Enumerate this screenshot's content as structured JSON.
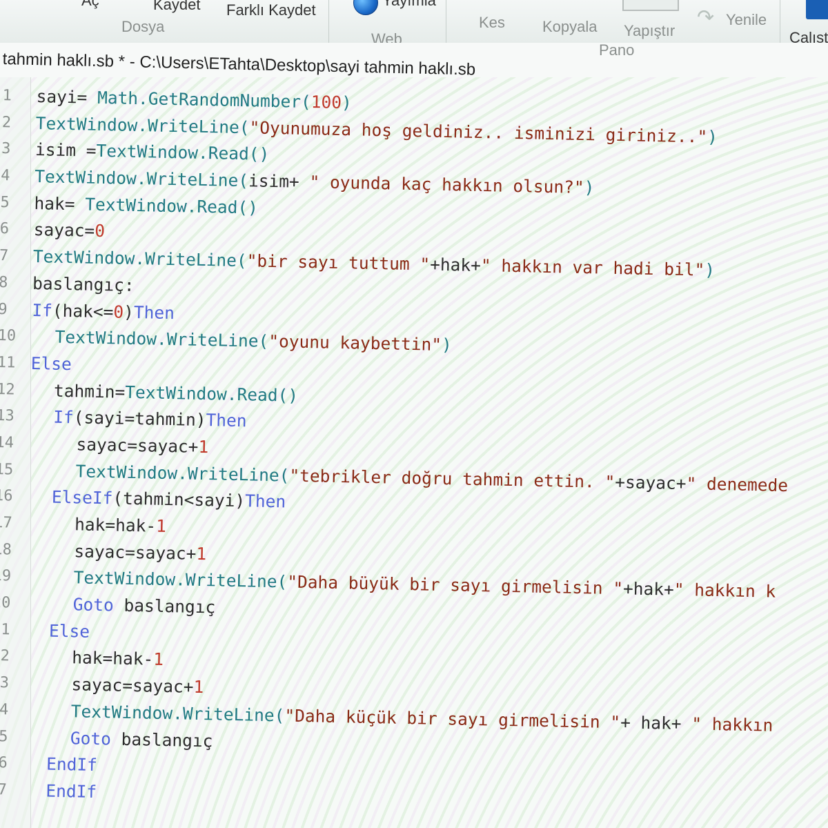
{
  "ribbon": {
    "items": {
      "open": "Aç",
      "save": "Kaydet",
      "save_as": "Farklı Kaydet",
      "publish": "Yayımla",
      "cut": "Kes",
      "copy": "Kopyala",
      "paste": "Yapıştır",
      "redo": "Yenile",
      "run": "Çalıştı"
    },
    "groups": {
      "file": "Dosya",
      "web": "Web",
      "clipboard": "Pano"
    }
  },
  "document": {
    "title": "tahmin haklı.sb * - C:\\Users\\ETahta\\Desktop\\sayi tahmin haklı.sb"
  },
  "editor": {
    "lines": [
      {
        "n": "1",
        "indent": 0,
        "tokens": [
          [
            "plain",
            "sayi= "
          ],
          [
            "obj",
            "Math.GetRandomNumber("
          ],
          [
            "num",
            "100"
          ],
          [
            "obj",
            ")"
          ]
        ]
      },
      {
        "n": "2",
        "indent": 0,
        "tokens": [
          [
            "obj",
            "TextWindow.WriteLine("
          ],
          [
            "str",
            "\"Oyunumuza hoş geldiniz.. isminizi giriniz..\""
          ],
          [
            "obj",
            ")"
          ]
        ]
      },
      {
        "n": "3",
        "indent": 0,
        "tokens": [
          [
            "plain",
            "isim ="
          ],
          [
            "obj",
            "TextWindow.Read()"
          ]
        ]
      },
      {
        "n": "4",
        "indent": 0,
        "tokens": [
          [
            "obj",
            "TextWindow.WriteLine("
          ],
          [
            "plain",
            "isim+ "
          ],
          [
            "str",
            "\" oyunda kaç hakkın olsun?\""
          ],
          [
            "obj",
            ")"
          ]
        ]
      },
      {
        "n": "5",
        "indent": 0,
        "tokens": [
          [
            "plain",
            "hak= "
          ],
          [
            "obj",
            "TextWindow.Read()"
          ]
        ]
      },
      {
        "n": "6",
        "indent": 0,
        "tokens": [
          [
            "plain",
            "sayac="
          ],
          [
            "num",
            "0"
          ]
        ]
      },
      {
        "n": "7",
        "indent": 0,
        "tokens": [
          [
            "obj",
            "TextWindow.WriteLine("
          ],
          [
            "str",
            "\"bir sayı tuttum \""
          ],
          [
            "plain",
            "+hak+"
          ],
          [
            "str",
            "\" hakkın var hadi bil\""
          ],
          [
            "obj",
            ")"
          ]
        ]
      },
      {
        "n": "8",
        "indent": 0,
        "tokens": [
          [
            "plain",
            "baslangıç:"
          ]
        ]
      },
      {
        "n": "9",
        "indent": 0,
        "tokens": [
          [
            "kw",
            "If"
          ],
          [
            "plain",
            "(hak<="
          ],
          [
            "num",
            "0"
          ],
          [
            "plain",
            ")"
          ],
          [
            "kw",
            "Then"
          ]
        ]
      },
      {
        "n": "10",
        "indent": 1,
        "tokens": [
          [
            "obj",
            "TextWindow.WriteLine("
          ],
          [
            "str",
            "\"oyunu kaybettin\""
          ],
          [
            "obj",
            ")"
          ]
        ]
      },
      {
        "n": "11",
        "indent": 0,
        "tokens": [
          [
            "kw",
            "Else"
          ]
        ]
      },
      {
        "n": "12",
        "indent": 1,
        "tokens": [
          [
            "plain",
            "tahmin="
          ],
          [
            "obj",
            "TextWindow.Read()"
          ]
        ]
      },
      {
        "n": "13",
        "indent": 1,
        "tokens": [
          [
            "kw",
            "If"
          ],
          [
            "plain",
            "(sayi=tahmin)"
          ],
          [
            "kw",
            "Then"
          ]
        ]
      },
      {
        "n": "14",
        "indent": 2,
        "tokens": [
          [
            "plain",
            "sayac=sayac+"
          ],
          [
            "num",
            "1"
          ]
        ]
      },
      {
        "n": "15",
        "indent": 2,
        "tokens": [
          [
            "obj",
            "TextWindow.WriteLine("
          ],
          [
            "str",
            "\"tebrikler doğru tahmin ettin. \""
          ],
          [
            "plain",
            "+sayac+"
          ],
          [
            "str",
            "\" denemede"
          ]
        ]
      },
      {
        "n": "16",
        "indent": 1,
        "tokens": [
          [
            "kw",
            "ElseIf"
          ],
          [
            "plain",
            "(tahmin<sayi)"
          ],
          [
            "kw",
            "Then"
          ]
        ]
      },
      {
        "n": "17",
        "indent": 2,
        "tokens": [
          [
            "plain",
            "hak=hak-"
          ],
          [
            "num",
            "1"
          ]
        ]
      },
      {
        "n": "18",
        "indent": 2,
        "tokens": [
          [
            "plain",
            "sayac=sayac+"
          ],
          [
            "num",
            "1"
          ]
        ]
      },
      {
        "n": "19",
        "indent": 2,
        "tokens": [
          [
            "obj",
            "TextWindow.WriteLine("
          ],
          [
            "str",
            "\"Daha büyük bir sayı girmelisin \""
          ],
          [
            "plain",
            "+hak+"
          ],
          [
            "str",
            "\" hakkın k"
          ]
        ]
      },
      {
        "n": "20",
        "indent": 2,
        "tokens": [
          [
            "kw",
            "Goto"
          ],
          [
            "plain",
            " baslangıç"
          ]
        ]
      },
      {
        "n": "21",
        "indent": 1,
        "tokens": [
          [
            "kw",
            "Else"
          ]
        ]
      },
      {
        "n": "22",
        "indent": 2,
        "tokens": [
          [
            "plain",
            "hak=hak-"
          ],
          [
            "num",
            "1"
          ]
        ]
      },
      {
        "n": "23",
        "indent": 2,
        "tokens": [
          [
            "plain",
            "sayac=sayac+"
          ],
          [
            "num",
            "1"
          ]
        ]
      },
      {
        "n": "24",
        "indent": 2,
        "tokens": [
          [
            "obj",
            "TextWindow.WriteLine("
          ],
          [
            "str",
            "\"Daha küçük bir sayı girmelisin \""
          ],
          [
            "plain",
            "+ hak+ "
          ],
          [
            "str",
            "\" hakkın"
          ]
        ]
      },
      {
        "n": "25",
        "indent": 2,
        "tokens": [
          [
            "kw",
            "Goto"
          ],
          [
            "plain",
            " baslangıç"
          ]
        ]
      },
      {
        "n": "26",
        "indent": 1,
        "tokens": [
          [
            "kw",
            "EndIf"
          ]
        ]
      },
      {
        "n": "27",
        "indent": 1,
        "tokens": [
          [
            "kw",
            "EndIf"
          ]
        ]
      }
    ]
  }
}
